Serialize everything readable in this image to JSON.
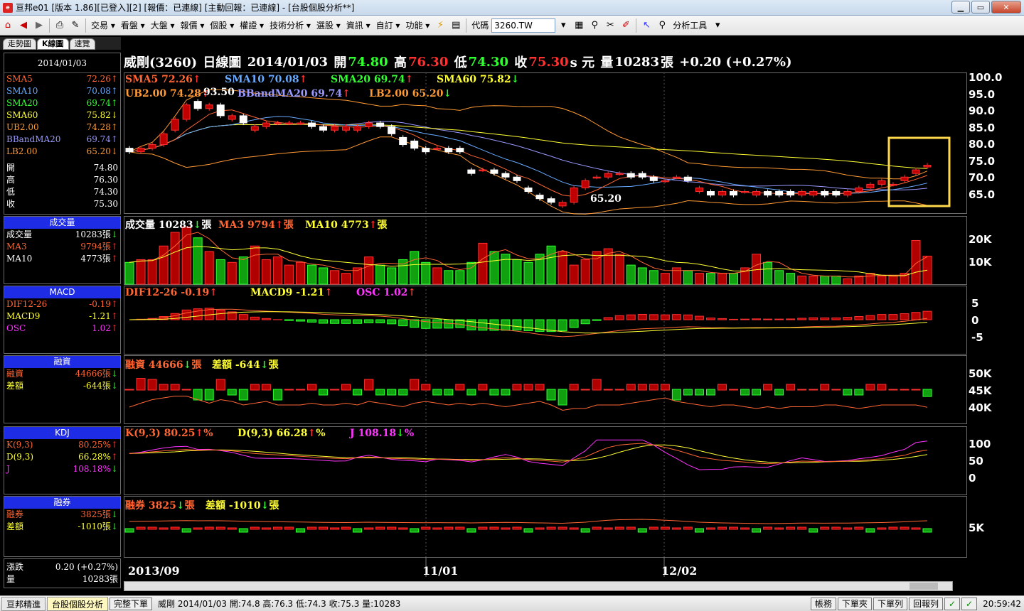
{
  "window": {
    "title": "亘邦e01 [版本 1.86][已登入][2] [報價：已連線] [主動回報：已連線] - [台股個股分析**]",
    "min": "▁",
    "max": "▭",
    "close": "✕"
  },
  "toolbar": {
    "menus": [
      "交易",
      "看盤",
      "大盤",
      "報價",
      "個股",
      "權證",
      "技術分析",
      "選股",
      "資訊",
      "自訂",
      "功能"
    ],
    "code_label": "代碼",
    "code_value": "3260.TW",
    "analysis_tool": "分析工具"
  },
  "tabs": [
    "走勢圖",
    "K線圖",
    "速覽"
  ],
  "sidebar": {
    "date": "2014/01/03",
    "price_rows": [
      {
        "label": "SMA5",
        "value": "72.26",
        "arrow": "↑",
        "color": "#ff6633"
      },
      {
        "label": "SMA10",
        "value": "70.08",
        "arrow": "↑",
        "color": "#66aaff"
      },
      {
        "label": "SMA20",
        "value": "69.74",
        "arrow": "↑",
        "color": "#33ff33"
      },
      {
        "label": "SMA60",
        "value": "75.82",
        "arrow": "↓",
        "color": "#ffff33"
      },
      {
        "label": "UB2.00",
        "value": "74.28",
        "arrow": "↑",
        "color": "#ff9933"
      },
      {
        "label": "BBandMA20",
        "value": "69.74",
        "arrow": "↑",
        "color": "#9999ff"
      },
      {
        "label": "LB2.00",
        "value": "65.20",
        "arrow": "↓",
        "color": "#ff9933"
      }
    ],
    "ohlc": [
      {
        "label": "開",
        "value": "74.80"
      },
      {
        "label": "高",
        "value": "76.30"
      },
      {
        "label": "低",
        "value": "74.30"
      },
      {
        "label": "收",
        "value": "75.30"
      }
    ],
    "volume": {
      "title": "成交量",
      "rows": [
        {
          "label": "成交量",
          "value": "10283張",
          "arrow": "↓",
          "color": "#ffffff"
        },
        {
          "label": "MA3",
          "value": "9794張",
          "arrow": "↑",
          "color": "#ff6633"
        },
        {
          "label": "MA10",
          "value": "4773張",
          "arrow": "↑",
          "color": "#ffffff"
        }
      ]
    },
    "macd": {
      "title": "MACD",
      "rows": [
        {
          "label": "DIF12-26",
          "value": "-0.19",
          "arrow": "↑",
          "color": "#ff6633"
        },
        {
          "label": "MACD9",
          "value": "-1.21",
          "arrow": "↑",
          "color": "#ffff33"
        },
        {
          "label": "OSC",
          "value": "1.02",
          "arrow": "↑",
          "color": "#ff33ff"
        }
      ]
    },
    "margin": {
      "title": "融資",
      "rows": [
        {
          "label": "融資",
          "value": "44666張",
          "arrow": "↓",
          "color": "#ff6633"
        },
        {
          "label": "差額",
          "value": "-644張",
          "arrow": "↓",
          "color": "#ffff33"
        }
      ]
    },
    "kdj": {
      "title": "KDJ",
      "rows": [
        {
          "label": "K(9,3)",
          "value": "80.25%",
          "arrow": "↑",
          "color": "#ff6633"
        },
        {
          "label": "D(9,3)",
          "value": "66.28%",
          "arrow": "↑",
          "color": "#ffff33"
        },
        {
          "label": "J",
          "value": "108.18%",
          "arrow": "↓",
          "color": "#ff33ff"
        }
      ]
    },
    "short": {
      "title": "融券",
      "rows": [
        {
          "label": "融券",
          "value": "3825張",
          "arrow": "↓",
          "color": "#ff6633"
        },
        {
          "label": "差額",
          "value": "-1010張",
          "arrow": "↓",
          "color": "#ffff33"
        }
      ]
    },
    "bottom": [
      {
        "label": "漲跌",
        "value": "0.20 (+0.27%)"
      },
      {
        "label": "量",
        "value": "10283張"
      }
    ]
  },
  "header": {
    "name": "威剛(3260)",
    "period": "日線圖",
    "date": "2014/01/03",
    "open_label": "開",
    "open": "74.80",
    "high_label": "高",
    "high": "76.30",
    "low_label": "低",
    "low": "74.30",
    "close_label": "收",
    "close": "75.30",
    "unit": "s 元",
    "vol_label": "量",
    "vol": "10283",
    "vol_unit": "張",
    "change": "+0.20 (+0.27%)"
  },
  "legends": {
    "price1": [
      {
        "t": "SMA5 72.26",
        "a": "↑",
        "c": "#ff6633"
      },
      {
        "t": "SMA10 70.08",
        "a": "↑",
        "c": "#66aaff"
      },
      {
        "t": "SMA20 69.74",
        "a": "↑",
        "c": "#33ff33"
      },
      {
        "t": "SMA60 75.82",
        "a": "↓",
        "c": "#ffff33"
      }
    ],
    "price2": [
      {
        "t": "UB2.00 74.28",
        "a": "↑",
        "c": "#ff9933"
      },
      {
        "t": "BBandMA20 69.74",
        "a": "↑",
        "c": "#9999ff"
      },
      {
        "t": "LB2.00 65.20",
        "a": "↓",
        "c": "#ff9933"
      }
    ],
    "vol": [
      {
        "t": "成交量 10283",
        "a": "↓",
        "u": "張",
        "c": "#ffffff"
      },
      {
        "t": "MA3 9794",
        "a": "↑",
        "u": "張",
        "c": "#ff6633"
      },
      {
        "t": "MA10 4773",
        "a": "↑",
        "u": "張",
        "c": "#ffff33"
      }
    ],
    "macd": [
      {
        "t": "DIF12-26 -0.19",
        "a": "↑",
        "c": "#ff6633"
      },
      {
        "t": "MACD9 -1.21",
        "a": "↑",
        "c": "#ffff33"
      },
      {
        "t": "OSC 1.02",
        "a": "↑",
        "c": "#ff33ff"
      }
    ],
    "margin": [
      {
        "t": "融資 44666",
        "a": "↓",
        "u": "張",
        "c": "#ff6633"
      },
      {
        "t": "差額 -644",
        "a": "↓",
        "u": "張",
        "c": "#ffff33"
      }
    ],
    "kdj": [
      {
        "t": "K(9,3) 80.25",
        "a": "↑",
        "u": "%",
        "c": "#ff6633"
      },
      {
        "t": "D(9,3) 66.28",
        "a": "↑",
        "u": "%",
        "c": "#ffff33"
      },
      {
        "t": "J 108.18",
        "a": "↓",
        "u": "%",
        "c": "#ff33ff"
      }
    ],
    "short": [
      {
        "t": "融券 3825",
        "a": "↓",
        "u": "張",
        "c": "#ff6633"
      },
      {
        "t": "差額 -1010",
        "a": "↓",
        "u": "張",
        "c": "#ffff33"
      }
    ]
  },
  "axes": {
    "price": [
      "100.0",
      "95.0",
      "90.0",
      "85.0",
      "80.0",
      "75.0",
      "70.0",
      "65.0"
    ],
    "vol": [
      "20K",
      "10K"
    ],
    "macd": [
      "5",
      "0",
      "-5"
    ],
    "margin": [
      "50K",
      "45K",
      "40K"
    ],
    "kdj": [
      "100",
      "50",
      "0"
    ],
    "short": [
      "5K"
    ],
    "x": [
      "2013/09",
      "11/01",
      "12/02"
    ]
  },
  "annotations": {
    "high_mark": "93.50",
    "low_mark": "65.20"
  },
  "chart_data": {
    "type": "candlestick",
    "ylim": [
      62,
      101
    ],
    "opens": [
      80,
      79,
      80,
      81,
      85,
      88,
      93,
      91,
      92,
      88,
      89,
      85,
      86,
      87,
      87,
      87,
      87,
      86,
      85,
      85,
      85,
      86,
      87,
      86,
      83,
      82,
      80,
      80,
      80,
      80,
      74,
      74,
      74,
      73,
      72,
      69,
      67,
      66,
      64,
      65,
      69,
      72,
      72,
      73,
      73,
      73,
      72,
      71,
      72,
      72,
      68,
      68,
      67,
      68,
      68,
      67,
      68,
      68,
      68,
      67,
      67,
      68,
      68,
      67,
      68,
      69,
      70,
      70,
      71,
      73,
      74.8
    ],
    "closes": [
      79,
      80,
      81,
      84,
      88,
      92,
      91,
      92,
      89,
      89,
      87,
      86,
      87,
      87,
      87,
      87,
      86,
      85,
      86,
      86,
      86,
      87,
      86,
      84,
      81,
      80,
      79,
      80,
      79,
      79,
      73,
      74,
      73,
      72,
      71,
      68,
      66,
      65,
      65,
      69,
      71,
      72,
      73,
      73,
      72,
      72,
      71,
      71,
      72,
      71,
      69,
      67,
      68,
      67,
      68,
      68,
      67,
      67,
      67,
      68,
      68,
      67,
      67,
      68,
      69,
      70,
      71,
      70,
      72,
      74,
      75.3
    ],
    "volume_k": [
      8,
      9,
      9,
      14,
      19,
      21,
      17,
      12,
      9,
      8,
      10,
      14,
      9,
      10,
      7,
      8,
      7,
      6,
      5,
      4,
      6,
      10,
      7,
      6,
      9,
      12,
      8,
      6,
      5,
      5,
      8,
      15,
      12,
      11,
      9,
      8,
      11,
      14,
      12,
      7,
      9,
      12,
      13,
      11,
      7,
      6,
      5,
      4,
      6,
      5,
      4,
      4,
      4,
      4,
      6,
      11,
      8,
      5,
      4,
      3,
      3,
      3,
      3,
      2,
      3,
      4,
      3,
      3,
      4,
      16,
      10.3
    ],
    "margin_k": [
      44.8,
      47,
      49,
      50,
      51,
      51,
      49,
      47,
      49,
      48,
      46,
      47,
      48,
      46,
      46,
      46,
      47,
      46,
      46,
      47,
      46,
      48,
      47,
      46,
      45,
      47,
      48,
      47,
      46,
      47,
      46,
      47,
      46,
      45,
      46,
      47,
      48,
      46,
      43,
      44,
      44,
      46,
      46,
      46,
      47,
      48,
      49,
      50,
      48,
      47,
      46,
      45,
      46,
      46,
      45,
      44,
      45,
      44,
      45,
      45,
      45,
      46,
      46,
      45,
      44,
      45,
      46,
      46,
      46,
      46,
      44.7
    ],
    "kdj_k": [
      70,
      72,
      75,
      78,
      80,
      82,
      80,
      81,
      80,
      78,
      74,
      70,
      68,
      66,
      64,
      62,
      60,
      58,
      56,
      55,
      58,
      60,
      58,
      56,
      55,
      54,
      52,
      54,
      53,
      52,
      50,
      52,
      55,
      58,
      56,
      52,
      50,
      48,
      45,
      52,
      60,
      75,
      88,
      95,
      98,
      100,
      95,
      88,
      80,
      70,
      60,
      55,
      50,
      48,
      45,
      42,
      40,
      42,
      45,
      48,
      47,
      46,
      47,
      48,
      50,
      52,
      55,
      60,
      65,
      75,
      80.25
    ]
  }
}
